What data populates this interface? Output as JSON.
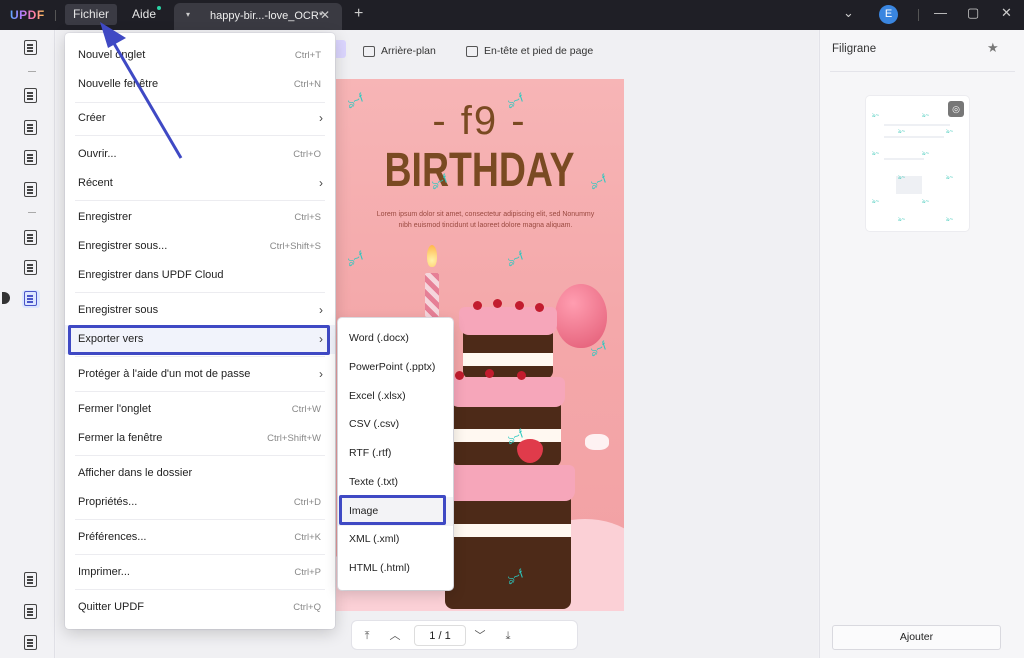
{
  "app": {
    "logo": "UPDF",
    "menu": {
      "file": "Fichier",
      "help": "Aide"
    },
    "tab": {
      "caret": "▾",
      "title": "happy-bir...-love_OCR*",
      "close": "✕"
    },
    "new_tab": "+",
    "avatar_initial": "E",
    "window_controls": {
      "dropdown": "⌄",
      "minimize": "—",
      "maximize": "▢",
      "close": "✕"
    }
  },
  "toolbar": {
    "background_label": "Arrière-plan",
    "header_footer_label": "En-tête et pied de page"
  },
  "document": {
    "heading": "- f9 -",
    "title": "BIRTHDAY",
    "lorem": "Lorem ipsum dolor sit amet, consectetur adipiscing elit, sed Nonummy nibh euismod tincidunt ut laoreet dolore magna aliquam."
  },
  "page_nav": {
    "first": "⤒",
    "prev": "︿",
    "current": "1 / 1",
    "next": "﹀",
    "last": "⤓"
  },
  "right_panel": {
    "title": "Filigrane",
    "star": "★",
    "add_button": "Ajouter"
  },
  "file_menu": {
    "items": [
      {
        "label": "Nouvel onglet",
        "shortcut": "Ctrl+T"
      },
      {
        "label": "Nouvelle fenêtre",
        "shortcut": "Ctrl+N"
      },
      {
        "label": "Créer",
        "shortcut": "",
        "submenu": true
      },
      {
        "label": "Ouvrir...",
        "shortcut": "Ctrl+O"
      },
      {
        "label": "Récent",
        "shortcut": "",
        "submenu": true
      },
      {
        "label": "Enregistrer",
        "shortcut": "Ctrl+S"
      },
      {
        "label": "Enregistrer sous...",
        "shortcut": "Ctrl+Shift+S"
      },
      {
        "label": "Enregistrer dans UPDF Cloud",
        "shortcut": ""
      },
      {
        "label": "Enregistrer sous",
        "shortcut": "",
        "submenu": true
      },
      {
        "label": "Exporter vers",
        "shortcut": "",
        "submenu": true
      },
      {
        "label": "Protéger à l'aide d'un mot de passe",
        "shortcut": "",
        "submenu": true
      },
      {
        "label": "Fermer l'onglet",
        "shortcut": "Ctrl+W"
      },
      {
        "label": "Fermer la fenêtre",
        "shortcut": "Ctrl+Shift+W"
      },
      {
        "label": "Afficher dans le dossier",
        "shortcut": ""
      },
      {
        "label": "Propriétés...",
        "shortcut": "Ctrl+D"
      },
      {
        "label": "Préférences...",
        "shortcut": "Ctrl+K"
      },
      {
        "label": "Imprimer...",
        "shortcut": "Ctrl+P"
      },
      {
        "label": "Quitter UPDF",
        "shortcut": "Ctrl+Q"
      }
    ],
    "chevron": "›"
  },
  "export_submenu": {
    "items": [
      "Word (.docx)",
      "PowerPoint (.pptx)",
      "Excel (.xlsx)",
      "CSV (.csv)",
      "RTF (.rtf)",
      "Texte (.txt)",
      "Image",
      "XML (.xml)",
      "HTML (.html)"
    ],
    "selected": "Image"
  },
  "colors": {
    "titlebar": "#1f1f26",
    "highlight_box": "#3f49c4",
    "annotation_arrow": "#3f49c4",
    "page_pink": "#f4a8aa",
    "title_brown": "#7a4a22",
    "watermark": "#2bc9c0"
  },
  "icons": {
    "sidebar": [
      "reader-icon",
      "comment-icon",
      "edit-icon",
      "organize-icon",
      "form-icon",
      "ocr-icon",
      "crop-icon",
      "watermark-tool-icon",
      "layers-icon",
      "bookmark-icon",
      "attachment-icon"
    ],
    "toolbar": [
      "background-icon",
      "header-footer-icon"
    ]
  }
}
